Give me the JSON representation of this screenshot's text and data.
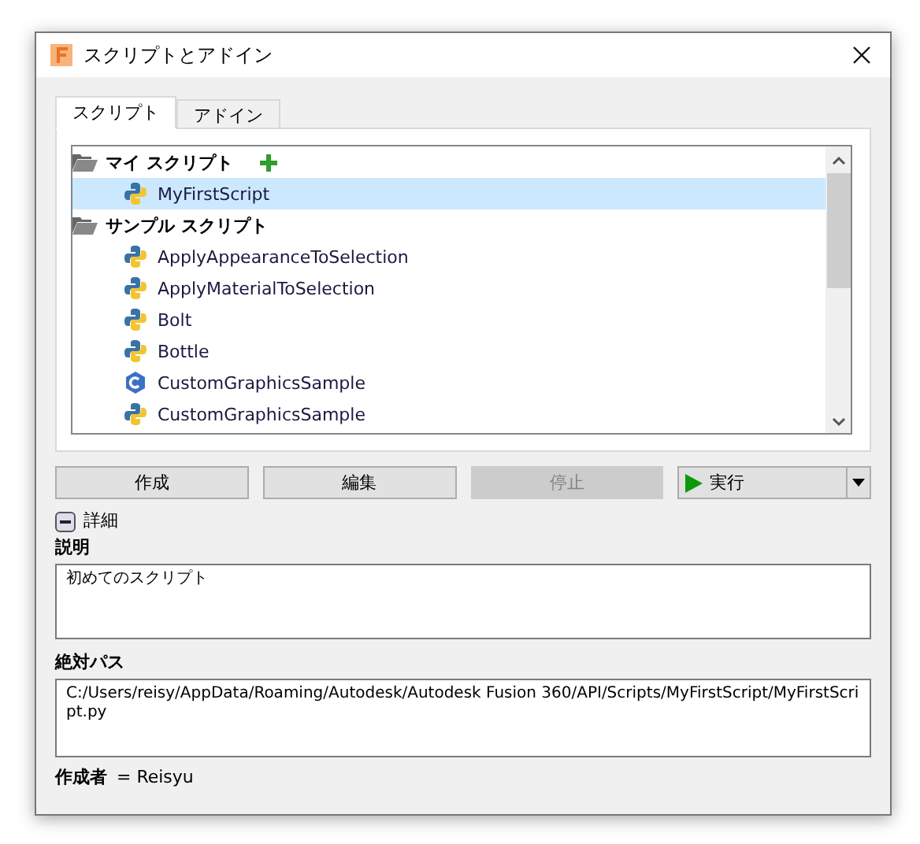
{
  "window": {
    "title": "スクリプトとアドイン"
  },
  "tabs": [
    {
      "label": "スクリプト",
      "selected": true
    },
    {
      "label": "アドイン",
      "selected": false
    }
  ],
  "tree": [
    {
      "label": "マイ スクリプト",
      "can_add": true,
      "children": [
        {
          "label": "MyFirstScript",
          "kind": "python",
          "selected": true
        }
      ]
    },
    {
      "label": "サンプル スクリプト",
      "can_add": false,
      "children": [
        {
          "label": "ApplyAppearanceToSelection",
          "kind": "python",
          "selected": false
        },
        {
          "label": "ApplyMaterialToSelection",
          "kind": "python",
          "selected": false
        },
        {
          "label": "Bolt",
          "kind": "python",
          "selected": false
        },
        {
          "label": "Bottle",
          "kind": "python",
          "selected": false
        },
        {
          "label": "CustomGraphicsSample",
          "kind": "cpp",
          "selected": false
        },
        {
          "label": "CustomGraphicsSample",
          "kind": "python",
          "selected": false
        }
      ]
    }
  ],
  "buttons": [
    {
      "label": "作成",
      "kind": "plain",
      "disabled": false
    },
    {
      "label": "編集",
      "kind": "plain",
      "disabled": false
    },
    {
      "label": "停止",
      "kind": "plain",
      "disabled": true
    },
    {
      "label": "実行",
      "kind": "split",
      "disabled": false
    }
  ],
  "details": {
    "label": "詳細",
    "expanded": true,
    "description_label": "説明",
    "description": "初めてのスクリプト",
    "path_label": "絶対パス",
    "path": "C:/Users/reisy/AppData/Roaming/Autodesk/Autodesk Fusion 360/API/Scripts/MyFirstScript/MyFirstScript.py",
    "author_label": "作成者",
    "author": "= Reisyu"
  }
}
